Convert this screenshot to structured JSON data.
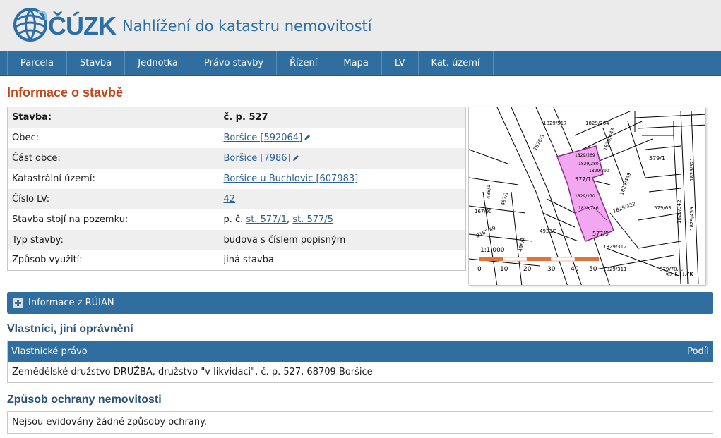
{
  "header": {
    "logo_text": "ČÚZK",
    "app_title": "Nahlížení do katastru nemovitostí"
  },
  "nav": {
    "items": [
      "Parcela",
      "Stavba",
      "Jednotka",
      "Právo stavby",
      "Řízení",
      "Mapa",
      "LV",
      "Kat. území"
    ]
  },
  "page": {
    "title": "Informace o stavbě"
  },
  "info": {
    "header_label": "Stavba:",
    "header_value": "č. p. 527",
    "rows": [
      {
        "label": "Obec:",
        "value": "Boršice [592064]"
      },
      {
        "label": "Část obce:",
        "value": "Boršice [7986]"
      },
      {
        "label": "Katastrální území:",
        "value": "Boršice u Buchlovic [607983]"
      },
      {
        "label": "Číslo LV:",
        "value": "42"
      },
      {
        "label": "Stavba stojí na pozemku:",
        "prefix": "p. č.",
        "link1": "st. 577/1",
        "sep": ",",
        "link2": "st. 577/5"
      },
      {
        "label": "Typ stavby:",
        "value": "budova s číslem popisným"
      },
      {
        "label": "Způsob využití:",
        "value": "jiná stavba"
      }
    ]
  },
  "map": {
    "scale_label": "1:1 000",
    "scale_ticks": [
      "0",
      "10",
      "20",
      "30",
      "40",
      "50"
    ],
    "copyright": "© ČÚZK",
    "parcel_labels": [
      "1829/264",
      "1829/443",
      "579/1",
      "577/1",
      "577/5",
      "579/63",
      "1829/449",
      "1829/322",
      "1829/312",
      "1829/311",
      "579/70",
      "2167/89",
      "1829/342",
      "1829/321",
      "1829/459",
      "1829/517",
      "497/1",
      "4933/3",
      "1576/3",
      "1829/269",
      "1829/270",
      "1829/280",
      "1829/290",
      "1829/246",
      "498/1",
      "496/1",
      "167/90"
    ]
  },
  "ruian": {
    "label": "Informace z RÚIAN"
  },
  "owners": {
    "section_title": "Vlastníci, jiní oprávnění",
    "col_right": "Vlastnické právo",
    "col_share": "Podíl",
    "row": "Zemědělské družstvo DRUŽBA, družstvo \"v likvidaci\", č. p. 527, 68709 Boršice"
  },
  "protection": {
    "section_title": "Způsob ochrany nemovitosti",
    "text": "Nejsou evidovány žádné způsoby ochrany."
  },
  "colors": {
    "brand_blue": "#2f6e9f",
    "title_orange": "#c0471a",
    "parcel_pink": "#f2a8f0"
  }
}
